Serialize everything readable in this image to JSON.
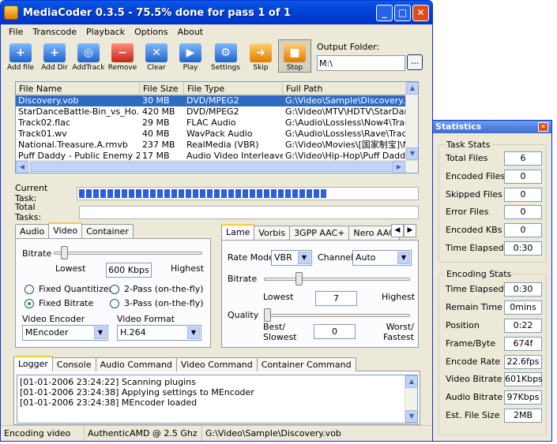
{
  "window": {
    "title": "MediaCoder 0.3.5 - 75.5% done for pass 1 of 1"
  },
  "menu": [
    "File",
    "Transcode",
    "Playback",
    "Options",
    "About"
  ],
  "toolbar": [
    {
      "label": "Add file",
      "icon": "add-file-icon"
    },
    {
      "label": "Add Dir",
      "icon": "add-dir-icon"
    },
    {
      "label": "AddTrack",
      "icon": "add-track-icon"
    },
    {
      "label": "Remove",
      "icon": "remove-icon"
    },
    {
      "label": "Clear",
      "icon": "clear-icon"
    },
    {
      "label": "Play",
      "icon": "play-icon"
    },
    {
      "label": "Settings",
      "icon": "settings-icon"
    },
    {
      "label": "Skip",
      "icon": "skip-icon"
    },
    {
      "label": "Stop",
      "icon": "stop-icon"
    }
  ],
  "output": {
    "label": "Output Folder:",
    "value": "M:\\",
    "browse": "..."
  },
  "filelist": {
    "headers": [
      "File Name",
      "File Size",
      "File Type",
      "Full Path"
    ],
    "rows": [
      [
        "Discovery.vob",
        "30 MB",
        "DVD/MPEG2",
        "G:\\Video\\Sample\\Discovery.vob"
      ],
      [
        "StarDanceBattle-Bin_vs_Ho...",
        "420 MB",
        "DVD/MPEG2",
        "G:\\Video\\MTV\\HDTV\\StarDanc..."
      ],
      [
        "Track02.flac",
        "29 MB",
        "FLAC Audio",
        "G:\\Audio\\Lossless\\Now4\\Track..."
      ],
      [
        "Track01.wv",
        "40 MB",
        "WavPack Audio",
        "G:\\Audio\\Lossless\\Rave\\Track..."
      ],
      [
        "National.Treasure.A.rmvb",
        "237 MB",
        "RealMedia (VBR)",
        "G:\\Video\\Movies\\[国家制宝]\\N..."
      ],
      [
        "Puff Daddy - Public Enemy 2...",
        "17 MB",
        "Audio Video Interleave",
        "G:\\Video\\Hip-Hop\\Puff Daddy ..."
      ]
    ]
  },
  "tasks": {
    "current_label": "Current Task:",
    "total_label": "Total Tasks:",
    "current_progress": 0.755,
    "total_progress": 0
  },
  "left_tabs": [
    "Audio",
    "Video",
    "Container"
  ],
  "video": {
    "bitrate_label": "Bitrate",
    "lowest": "Lowest",
    "highest": "Highest",
    "bitrate_value": "600 Kbps",
    "bitrate_level": 0.05,
    "radios": [
      "Fixed Quantitizer",
      "2-Pass (on-the-fly)",
      "Fixed Bitrate",
      "3-Pass (on-the-fly)"
    ],
    "encoder_label": "Video Encoder",
    "encoder": "MEncoder",
    "format_label": "Video Format",
    "format": "H.264"
  },
  "right_tabs": [
    "Lame",
    "Vorbis",
    "3GPP AAC+",
    "Nero AAC"
  ],
  "audio": {
    "ratemode_label": "Rate Mode",
    "ratemode": "VBR",
    "channel_label": "Channel",
    "channel": "Auto",
    "bitrate_label": "Bitrate",
    "lowest": "Lowest",
    "highest": "Highest",
    "bitrate_value": "7",
    "bitrate_level": 0.23,
    "quality_label": "Quality",
    "best": "Best/\nSlowest",
    "worst": "Worst/\nFastest",
    "quality_value": "0",
    "quality_level": 0
  },
  "bottom_tabs": [
    "Logger",
    "Console",
    "Audio Command",
    "Video Command",
    "Container Command"
  ],
  "log": [
    "[01-01-2006 23:24:22] Scanning plugins",
    "[01-01-2006 23:24:38] Applying settings to MEncoder",
    "[01-01-2006 23:24:38] MEncoder loaded"
  ],
  "status": [
    "Encoding video",
    "AuthenticAMD @ 2.5 Ghz",
    "G:\\Video\\Sample\\Discovery.vob"
  ],
  "stats": {
    "title": "Statistics",
    "task_title": "Task Stats",
    "task": [
      [
        "Total Files",
        "6"
      ],
      [
        "Encoded Files",
        "0"
      ],
      [
        "Skipped Files",
        "0"
      ],
      [
        "Error Files",
        "0"
      ],
      [
        "Encoded KBs",
        "0"
      ],
      [
        "Time Elapsed",
        "0:30"
      ]
    ],
    "enc_title": "Encoding Stats",
    "enc": [
      [
        "Time Elapsed",
        "0:30"
      ],
      [
        "Remain Time",
        "0mins"
      ],
      [
        "Position",
        "0:22"
      ],
      [
        "Frame/Byte",
        "674f"
      ],
      [
        "Encode Rate",
        "22.6fps"
      ],
      [
        "Video Bitrate",
        "601Kbps"
      ],
      [
        "Audio Bitrate",
        "97Kbps"
      ],
      [
        "Est. File Size",
        "2MB"
      ]
    ]
  }
}
